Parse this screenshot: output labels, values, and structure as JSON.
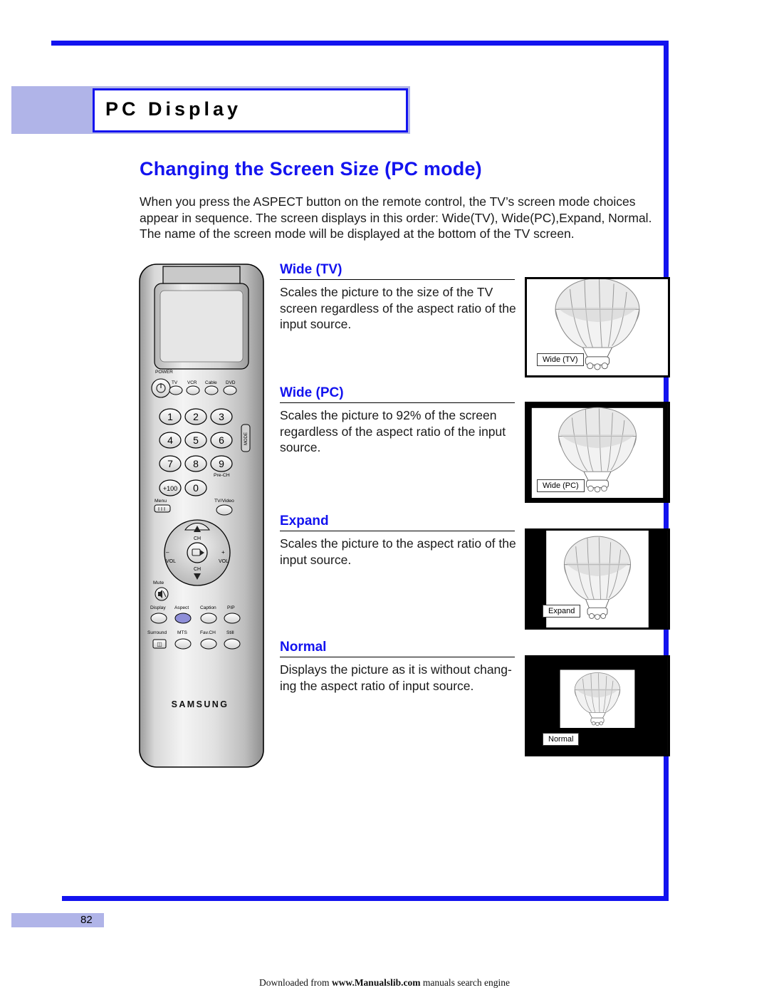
{
  "header": {
    "chapter_title": "PC Display",
    "section_title": "Changing the Screen Size (PC mode)",
    "intro": "When you press the ASPECT button on the remote control, the TV’s screen mode choices appear in sequence.  The screen displays in this order: Wide(TV), Wide(PC),Expand, Normal. The name of the screen mode will be displayed at the bottom of the TV screen."
  },
  "modes": [
    {
      "title": "Wide (TV)",
      "description": "Scales the picture to the size of the TV screen regardless of the aspect ratio of the input source.",
      "caption": "Wide (TV)"
    },
    {
      "title": "Wide (PC)",
      "description": "Scales the picture to 92% of the screen regardless of the aspect ratio of the input source.",
      "caption": "Wide (PC)"
    },
    {
      "title": "Expand",
      "description": "Scales the picture to the aspect ratio of the input source.",
      "caption": "Expand"
    },
    {
      "title": "Normal",
      "description": "Displays the picture as it is without chang- ing the aspect ratio of input source.",
      "caption": "Normal"
    }
  ],
  "remote": {
    "brand": "SAMSUNG",
    "power_label": "POWER",
    "device_buttons": [
      "TV",
      "VCR",
      "Cable",
      "DVD"
    ],
    "side_label": "MODE",
    "keys": [
      "1",
      "2",
      "3",
      "4",
      "5",
      "6",
      "7",
      "8",
      "9",
      "+100",
      "0"
    ],
    "pre_ch": "Pre-CH",
    "menu_label": "Menu",
    "tv_video_label": "TV/Video",
    "nav": {
      "up": "CH",
      "down": "CH",
      "left": "VOL",
      "right": "VOL",
      "minus": "–",
      "plus": "+"
    },
    "mute_label": "Mute",
    "row1": [
      "Display",
      "Aspect",
      "Caption",
      "PIP"
    ],
    "row2": [
      "Surround",
      "MTS",
      "Fav.CH",
      "Still"
    ]
  },
  "footer": {
    "page_number": "82",
    "download_prefix": "Downloaded from ",
    "download_link": "www.Manualslib.com",
    "download_suffix": " manuals search engine"
  },
  "colors": {
    "accent_blue": "#1313ef",
    "band_lavender": "#b0b4e8",
    "text": "#1a1a1a"
  }
}
